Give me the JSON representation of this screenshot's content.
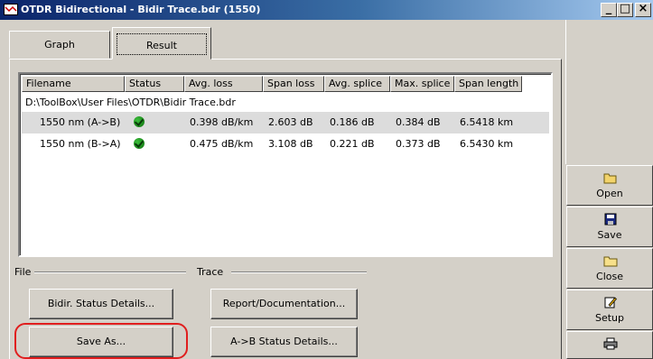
{
  "window": {
    "title": "OTDR Bidirectional - Bidir Trace.bdr (1550)",
    "controls": {
      "minimize": "_",
      "maximize": "□",
      "close": "×"
    }
  },
  "tabs": [
    {
      "label": "Graph"
    },
    {
      "label": "Result"
    }
  ],
  "table": {
    "columns": [
      "Filename",
      "Status",
      "Avg. loss",
      "Span loss",
      "Avg. splice",
      "Max. splice",
      "Span length"
    ],
    "path": "D:\\ToolBox\\User Files\\OTDR\\Bidir Trace.bdr",
    "rows": [
      {
        "filename": "1550 nm (A->B)",
        "status": "pass-icon",
        "avg_loss": "0.398 dB/km",
        "span_loss": "2.603 dB",
        "avg_splice": "0.186 dB",
        "max_splice": "0.384 dB",
        "span_length": "6.5418 km"
      },
      {
        "filename": "1550 nm (B->A)",
        "status": "pass-icon",
        "avg_loss": "0.475 dB/km",
        "span_loss": "3.108 dB",
        "avg_splice": "0.221 dB",
        "max_splice": "0.373 dB",
        "span_length": "6.5430 km"
      }
    ]
  },
  "groups": {
    "file": "File",
    "trace": "Trace"
  },
  "buttons": {
    "bidir_status": "Bidir. Status Details...",
    "save_as": "Save As...",
    "report": "Report/Documentation...",
    "ab_status": "A->B Status Details..."
  },
  "sidebar": {
    "open": "Open",
    "save": "Save",
    "close": "Close",
    "setup": "Setup"
  },
  "colors": {
    "titlebar_start": "#0a246a",
    "titlebar_end": "#a6caf0",
    "highlight_ring": "#e01e1e",
    "status_pass": "#1f8f1f"
  }
}
